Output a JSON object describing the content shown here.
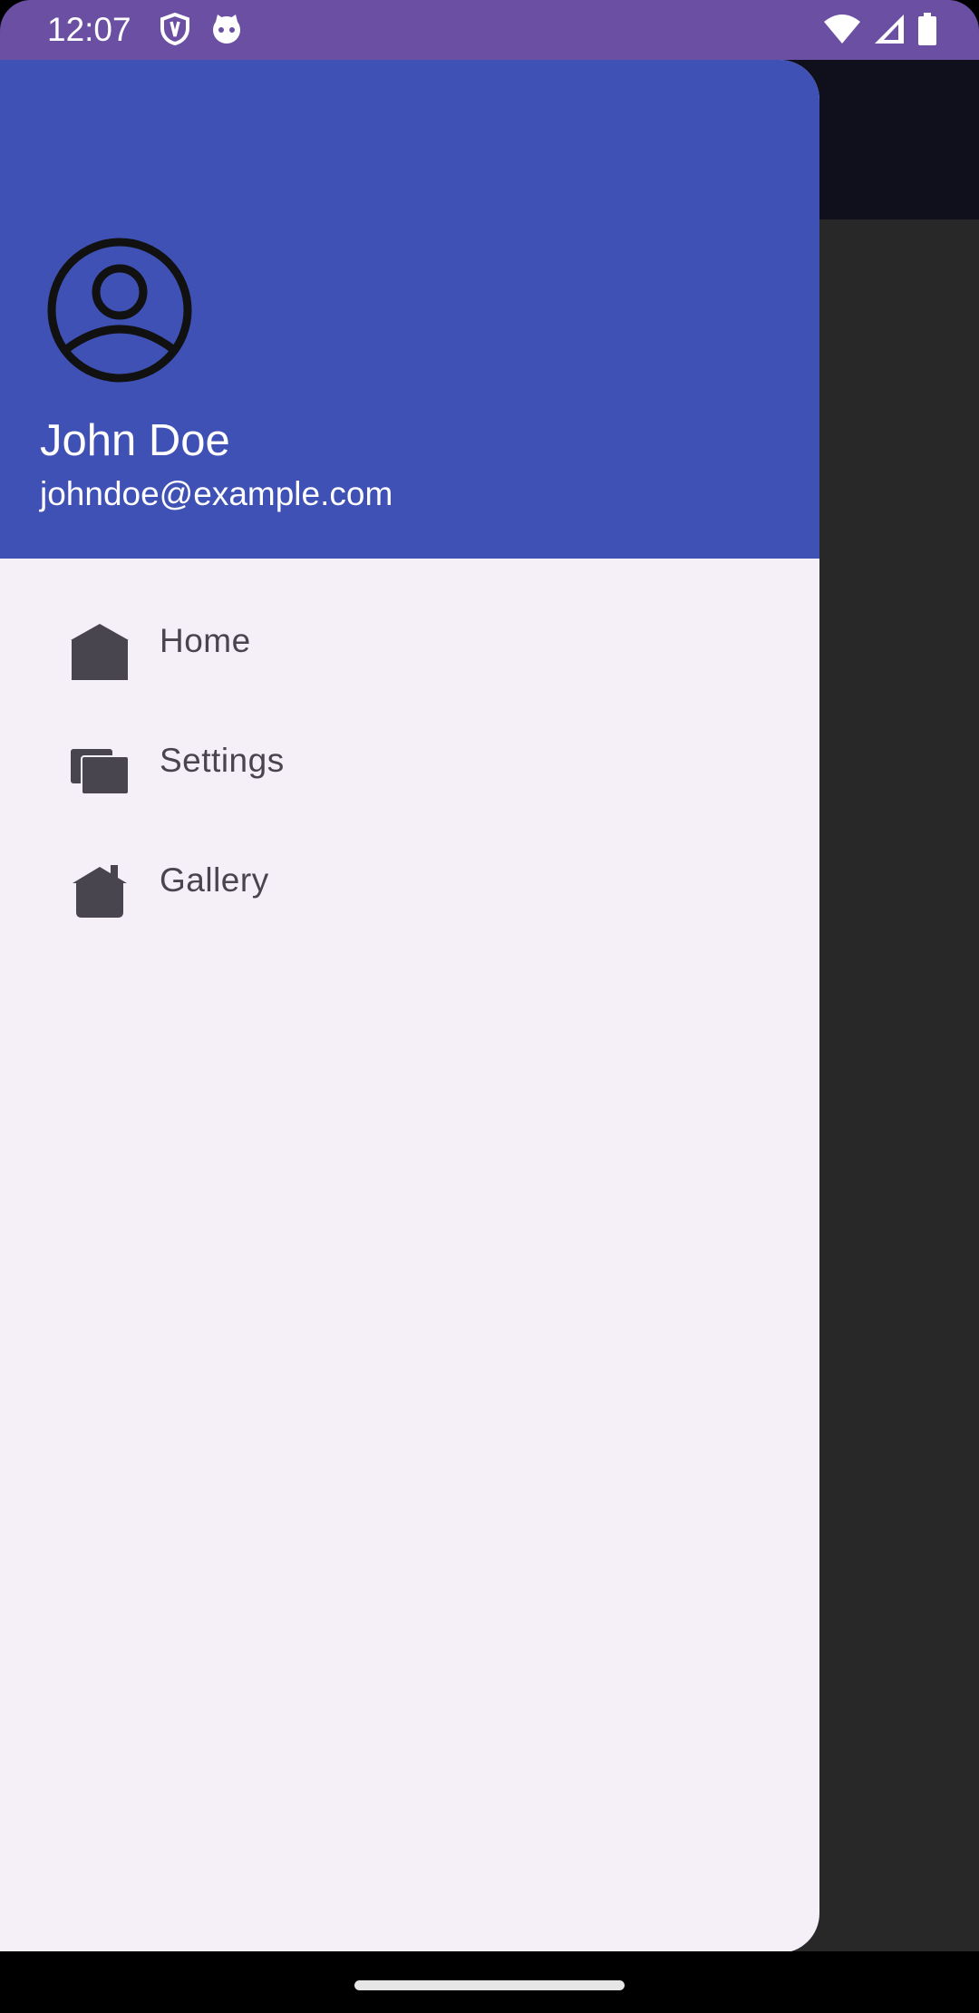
{
  "status_bar": {
    "time": "12:07",
    "left_icons": [
      "shield-icon",
      "cat-icon"
    ],
    "right_icons": [
      "wifi-icon",
      "signal-icon",
      "battery-icon"
    ],
    "color": "#6a4fa3"
  },
  "drawer": {
    "header": {
      "name": "John Doe",
      "email": "johndoe@example.com",
      "background_color": "#3f51b5",
      "avatar_icon": "account-circle-icon"
    },
    "menu_items": [
      {
        "label": "Home",
        "icon": "home-icon"
      },
      {
        "label": "Settings",
        "icon": "settings-icon"
      },
      {
        "label": "Gallery",
        "icon": "gallery-icon"
      }
    ]
  }
}
